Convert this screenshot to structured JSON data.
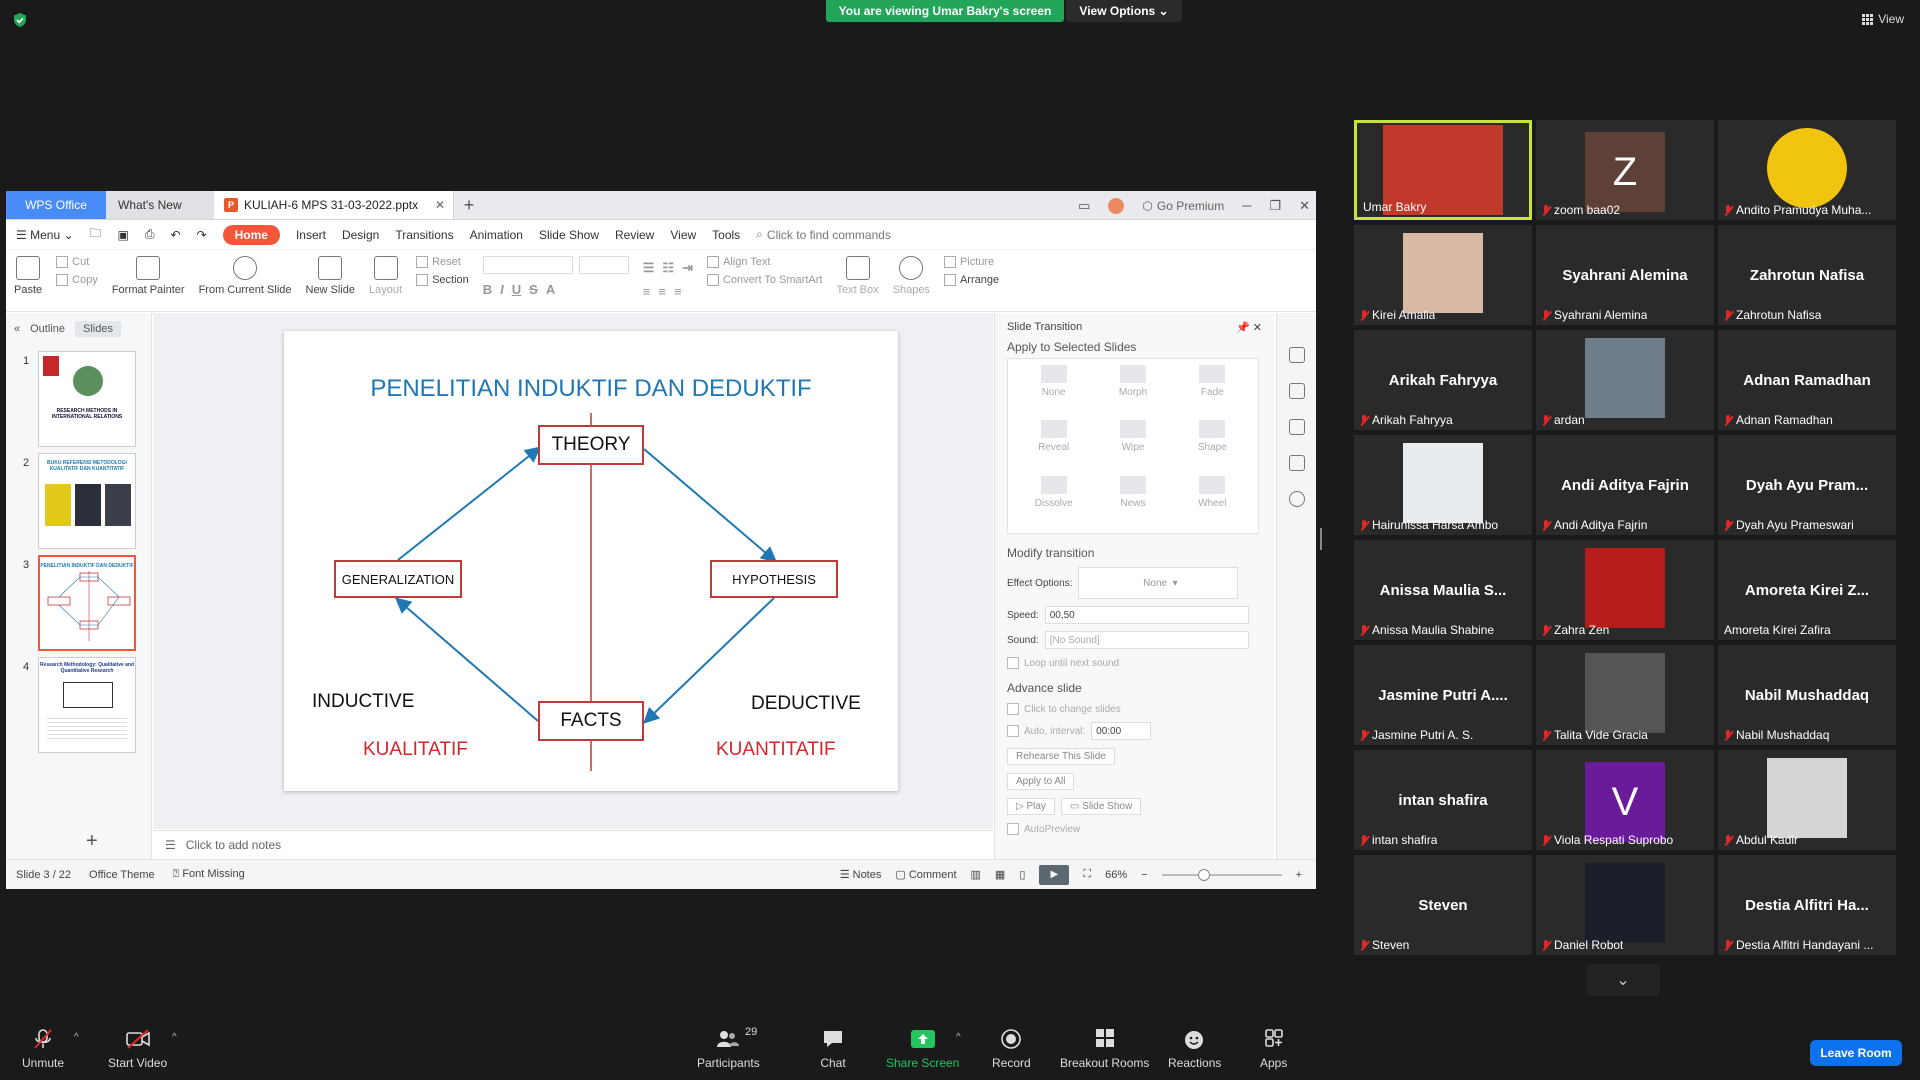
{
  "zoom": {
    "banner": "You are viewing Umar Bakry's screen",
    "view_options": "View Options",
    "view": "View",
    "leave": "Leave Room",
    "toolbar": [
      {
        "label": "Unmute"
      },
      {
        "label": "Start Video"
      },
      {
        "label": "Participants",
        "count": "29"
      },
      {
        "label": "Chat"
      },
      {
        "label": "Share Screen"
      },
      {
        "label": "Record"
      },
      {
        "label": "Breakout Rooms"
      },
      {
        "label": "Reactions"
      },
      {
        "label": "Apps"
      }
    ]
  },
  "wps": {
    "tab_app": "WPS Office",
    "tab_new": "What's New",
    "tab_file": "KULIAH-6 MPS 31-03-2022.pptx",
    "go_premium": "Go Premium",
    "menu": [
      "Menu",
      "Home",
      "Insert",
      "Design",
      "Transitions",
      "Animation",
      "Slide Show",
      "Review",
      "View",
      "Tools"
    ],
    "find": "Click to find commands",
    "ribbon": {
      "paste": "Paste",
      "cut": "Cut",
      "copy": "Copy",
      "format_painter": "Format Painter",
      "from_current": "From Current Slide",
      "new_slide": "New Slide",
      "layout": "Layout",
      "reset": "Reset",
      "section": "Section",
      "align_text": "Align Text",
      "convert": "Convert To SmartArt",
      "text_box": "Text Box",
      "shapes": "Shapes",
      "picture": "Picture",
      "arrange": "Arrange"
    },
    "pane_tabs": [
      "Outline",
      "Slides"
    ],
    "thumbs": [
      "1",
      "2",
      "3",
      "4"
    ],
    "thumb_texts": [
      "RESEARCH METHODS IN INTERNATIONAL RELATIONS",
      "BUKU REFERENSI METODOLOGI KUALITATIF DAN KUANTITATIF",
      "PENELITIAN INDUKTIF DAN DEDUKTIF",
      "Research Methodology: Qualitative and Quantitative Research"
    ],
    "slide": {
      "title": "PENELITIAN INDUKTIF DAN DEDUKTIF",
      "theory": "THEORY",
      "generalization": "GENERALIZATION",
      "hypothesis": "HYPOTHESIS",
      "facts": "FACTS",
      "inductive": "INDUCTIVE",
      "deductive": "DEDUCTIVE",
      "kualitatif": "KUALITATIF",
      "kuantitatif": "KUANTITATIF"
    },
    "notes": "Click to add notes",
    "transition": {
      "header": "Slide Transition",
      "apply_selected": "Apply to Selected Slides",
      "effects": [
        "None",
        "Morph",
        "Fade",
        "Reveal",
        "Wipe",
        "Shape",
        "Dissolve",
        "News",
        "Wheel"
      ],
      "modify": "Modify transition",
      "effect_options_label": "Effect Options:",
      "effect_options_value": "None",
      "speed_label": "Speed:",
      "speed_value": "00,50",
      "sound_label": "Sound:",
      "sound_value": "[No Sound]",
      "loop": "Loop until next sound",
      "advance": "Advance slide",
      "click_change": "Click to change slides",
      "auto_interval": "Auto, interval:",
      "interval_value": "00:00",
      "rehearse": "Rehearse This Slide",
      "apply_all": "Apply to All",
      "play": "Play",
      "slide_show": "Slide Show",
      "autopreview": "AutoPreview"
    },
    "status": {
      "slide_count": "Slide 3 / 22",
      "theme": "Office Theme",
      "font_missing": "Font Missing",
      "notes": "Notes",
      "comment": "Comment",
      "zoom": "66%"
    }
  },
  "participants": [
    {
      "caption": "Umar Bakry",
      "tile": "",
      "type": "photo",
      "color": "#c0392b",
      "muted": false,
      "active": true
    },
    {
      "caption": "zoom baa02",
      "tile": "",
      "type": "letter",
      "letter": "Z",
      "color": "#5d4037",
      "muted": true
    },
    {
      "caption": "Andito Pramudya Muha...",
      "tile": "",
      "type": "photo",
      "color": "#f1c40f",
      "muted": true
    },
    {
      "caption": "Kirei Amalia",
      "tile": "",
      "type": "photo",
      "color": "#d7b9a6",
      "muted": true
    },
    {
      "caption": "Syahrani Alemina",
      "tile": "Syahrani Alemina",
      "type": "name",
      "muted": true
    },
    {
      "caption": "Zahrotun Nafisa",
      "tile": "Zahrotun Nafisa",
      "type": "name",
      "muted": true
    },
    {
      "caption": "Arikah Fahryya",
      "tile": "Arikah Fahryya",
      "type": "name",
      "muted": true
    },
    {
      "caption": "ardan",
      "tile": "",
      "type": "photo",
      "color": "#6f7d88",
      "muted": true
    },
    {
      "caption": "Adnan Ramadhan",
      "tile": "Adnan Ramadhan",
      "type": "name",
      "muted": true
    },
    {
      "caption": "Hairunissa Harsa Ambo",
      "tile": "",
      "type": "photo",
      "color": "#e9ecef",
      "muted": true
    },
    {
      "caption": "Andi Aditya Fajrin",
      "tile": "Andi Aditya Fajrin",
      "type": "name",
      "muted": true
    },
    {
      "caption": "Dyah Ayu Prameswari",
      "tile": "Dyah Ayu Pram...",
      "type": "name",
      "muted": true
    },
    {
      "caption": "Anissa Maulia Shabine",
      "tile": "Anissa Maulia S...",
      "type": "name",
      "muted": true
    },
    {
      "caption": "Zahra Zen",
      "tile": "",
      "type": "photo",
      "color": "#b71c1c",
      "muted": true
    },
    {
      "caption": "Amoreta Kirei Zafira",
      "tile": "Amoreta Kirei Z...",
      "type": "name",
      "muted": false
    },
    {
      "caption": "Jasmine Putri A. S.",
      "tile": "Jasmine Putri A....",
      "type": "name",
      "muted": true
    },
    {
      "caption": "Talita Vide Gracia",
      "tile": "",
      "type": "photo",
      "color": "#555555",
      "muted": true
    },
    {
      "caption": "Nabil Mushaddaq",
      "tile": "Nabil Mushaddaq",
      "type": "name",
      "muted": true
    },
    {
      "caption": "intan shafira",
      "tile": "intan shafira",
      "type": "name",
      "muted": true
    },
    {
      "caption": "Viola Respati Suprobo",
      "tile": "",
      "type": "letter",
      "letter": "V",
      "color": "#6a1b9a",
      "muted": true
    },
    {
      "caption": "Abdul Kadir",
      "tile": "",
      "type": "photo",
      "color": "#d5d5d5",
      "muted": true
    },
    {
      "caption": "Steven",
      "tile": "Steven",
      "type": "name",
      "muted": true
    },
    {
      "caption": "Daniel Robot",
      "tile": "",
      "type": "photo",
      "color": "#1b1f2a",
      "muted": true
    },
    {
      "caption": "Destia Alfitri Handayani ...",
      "tile": "Destia Alfitri Ha...",
      "type": "name",
      "muted": true
    }
  ]
}
